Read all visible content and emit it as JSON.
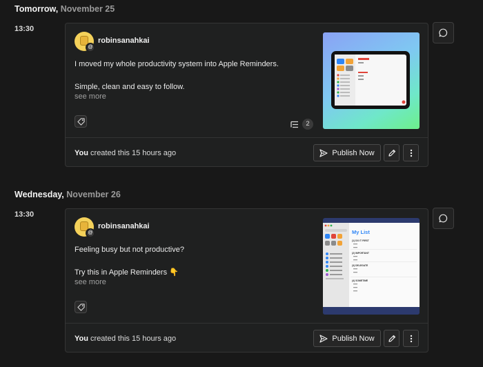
{
  "days": [
    {
      "day_label": "Tomorrow,",
      "date_label": "November 25",
      "time": "13:30",
      "post": {
        "username": "robinsanahkai",
        "paragraphs": [
          "I moved my whole productivity system into Apple Reminders.",
          "Simple, clean and easy to follow."
        ],
        "see_more": "see more",
        "thread_count": "2",
        "footer_bold": "You",
        "footer_rest": " created this 15 hours ago",
        "publish_label": "Publish Now"
      }
    },
    {
      "day_label": "Wednesday,",
      "date_label": "November 26",
      "time": "13:30",
      "post": {
        "username": "robinsanahkai",
        "paragraphs": [
          "Feeling busy but not productive?",
          "Try this in Apple Reminders 👇"
        ],
        "see_more": "see more",
        "footer_bold": "You",
        "footer_rest": " created this 15 hours ago",
        "publish_label": "Publish Now",
        "thumbnail": {
          "list_title": "My List",
          "sections": [
            "(1) DO IT FIRST",
            "(2) IMPORTANT",
            "(3) DELEGATE",
            "(4) SOMETIME"
          ],
          "item_label": "Task"
        }
      }
    }
  ],
  "icons": {
    "tag": "tag-icon",
    "thread": "thread-list-icon",
    "send": "send-icon",
    "edit": "pencil-icon",
    "more": "more-vertical-icon",
    "comment": "comment-icon"
  },
  "colors": {
    "background": "#181818",
    "card": "#1f2020",
    "avatar": "#f4d15a",
    "reminders_blue": "#2f86f6"
  }
}
